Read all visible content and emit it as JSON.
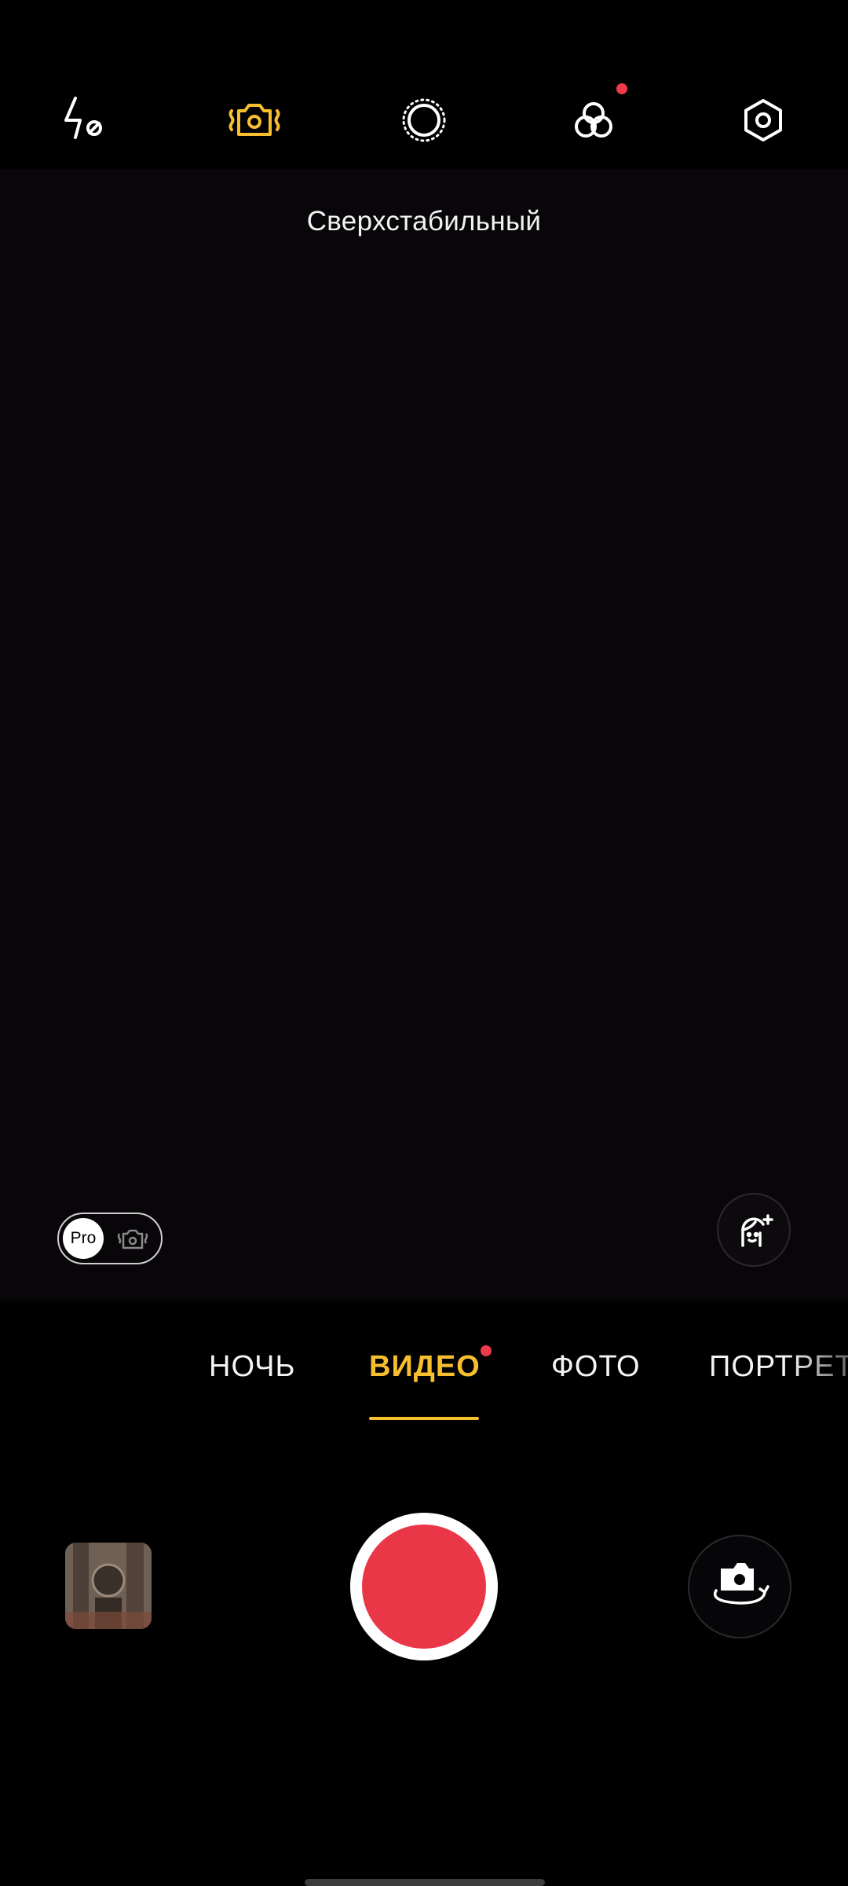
{
  "top_bar": {
    "icons": [
      {
        "name": "flash-off-icon",
        "active": false
      },
      {
        "name": "stabilization-camera-icon",
        "active": true
      },
      {
        "name": "live-photo-icon",
        "active": false
      },
      {
        "name": "filters-icon",
        "active": false,
        "has_notification": true
      },
      {
        "name": "settings-icon",
        "active": false
      }
    ]
  },
  "viewfinder": {
    "stabilization_label": "Сверхстабильный"
  },
  "pro_toggle": {
    "label": "Pro"
  },
  "modes": {
    "items": [
      "НОЧЬ",
      "ВИДЕО",
      "ФОТО",
      "ПОРТРЕТ"
    ],
    "selected": "ВИДЕО",
    "selected_has_notification": true
  },
  "colors": {
    "accent": "#f7bf2e",
    "record": "#ea3748",
    "notification": "#ee3a4a"
  }
}
